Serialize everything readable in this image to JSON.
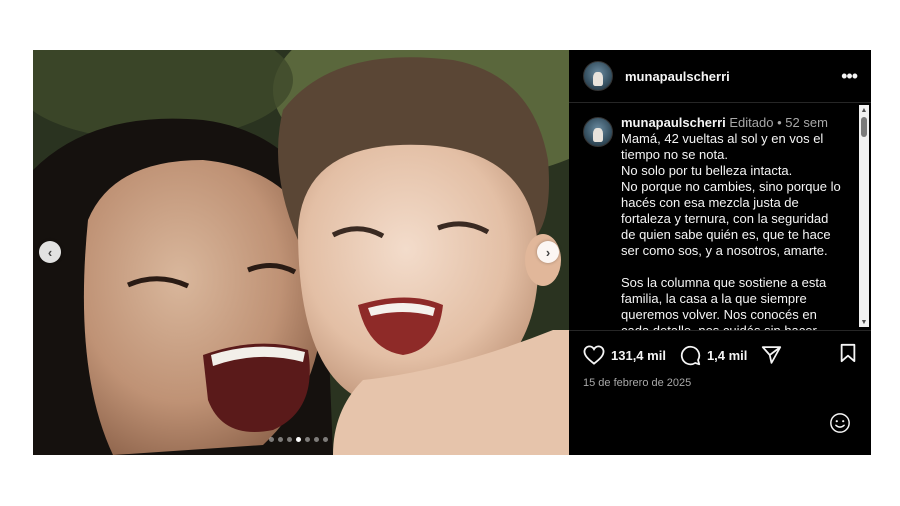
{
  "post": {
    "username": "munapaulscherri",
    "more_icon": "more-horizontal-icon",
    "caption": {
      "username": "munapaulscherri",
      "edited_label": "Editado",
      "separator": "•",
      "time_ago": "52 sem",
      "paragraphs": [
        "Mamá, 42 vueltas al sol y en vos el tiempo no se nota.",
        "No solo por tu belleza intacta.",
        "No porque no cambies, sino porque lo hacés con esa mezcla justa de fortaleza y ternura, con la seguridad de quien sabe quién es, que te hace ser como sos, y a nosotros, amarte.",
        "",
        "Sos la columna que sostiene a esta familia, la casa a la que siempre queremos volver. Nos conocés en cada detalle, nos cuidás sin hacer ruido, nos"
      ]
    },
    "likes": "131,4 mil",
    "comments": "1,4 mil",
    "date": "15 de febrero de 2025",
    "carousel": {
      "total": 7,
      "active_index": 3
    }
  },
  "icons": {
    "prev": "chevron-left-icon",
    "next": "chevron-right-icon",
    "like": "heart-icon",
    "comment": "comment-icon",
    "share": "send-icon",
    "save": "bookmark-icon",
    "emoji": "smiley-icon"
  },
  "colors": {
    "panel_bg": "#000000",
    "text": "#f5f5f5",
    "muted": "#a8a8a8"
  }
}
